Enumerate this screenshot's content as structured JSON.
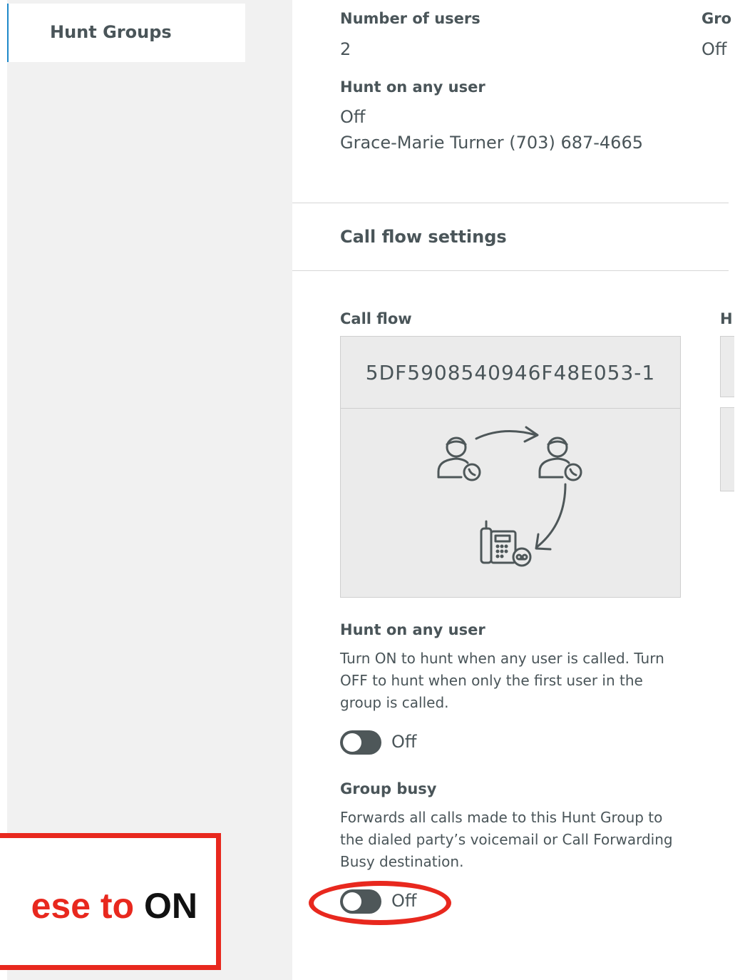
{
  "sidebar": {
    "items": [
      {
        "label": "Hunt Groups"
      }
    ]
  },
  "summary": {
    "number_of_users_label": "Number of users",
    "number_of_users_value": "2",
    "group_busy_label_partial": "Gro",
    "group_busy_value_partial": "Off",
    "hunt_any_label": "Hunt on any user",
    "hunt_any_value": "Off",
    "hunt_any_user": "Grace-Marie Turner (703) 687-4665"
  },
  "call_flow_settings": {
    "title": "Call flow settings",
    "call_flow_label": "Call flow",
    "side_label_partial": "H",
    "call_flow_id": "5DF5908540946F48E053-1"
  },
  "hunt_on_any_user": {
    "label": "Hunt on any user",
    "description": "Turn ON to hunt when any user is called. Turn OFF to hunt when only the first user in the group is called.",
    "state": "Off"
  },
  "group_busy": {
    "label": "Group busy",
    "description": "Forwards all calls made to this Hunt Group to the dialed party’s voicemail or Call Forwarding Busy destination.",
    "state": "Off"
  },
  "annotation": {
    "text_red": "ese to ",
    "text_black": "ON",
    "color": "#e8281e"
  },
  "icons": [
    "user-phone-icon",
    "arrow-icon",
    "desk-phone-voicemail-icon"
  ]
}
